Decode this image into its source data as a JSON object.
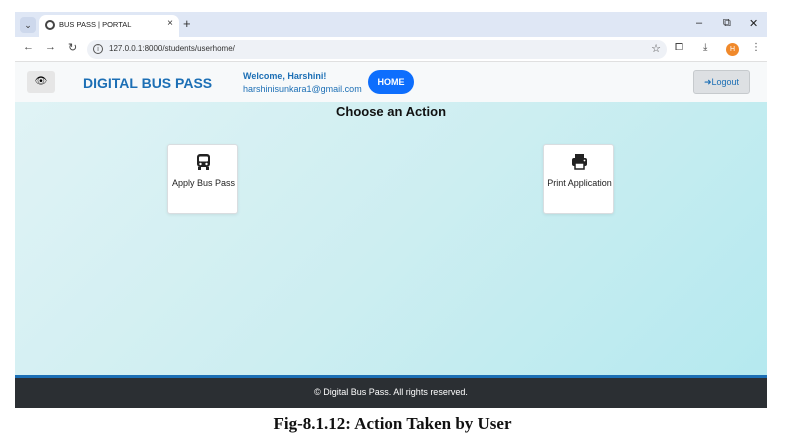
{
  "browser": {
    "tab_title": "BUS PASS | PORTAL",
    "tab_close": "×",
    "new_tab": "+",
    "url": "127.0.0.1:8000/students/userhome/",
    "profile_initial": "H",
    "icons": [
      "tab-menu-icon",
      "globe-icon",
      "close-icon",
      "plus-icon",
      "minimize-icon",
      "restore-icon",
      "window-close-icon",
      "back-icon",
      "forward-icon",
      "reload-icon",
      "info-icon",
      "star-icon",
      "extensions-icon",
      "download-icon",
      "menu-icon"
    ]
  },
  "navbar": {
    "brand": "DIGITAL BUS PASS",
    "welcome": "Welcome, Harshini!",
    "email": "harshinisunkara1@gmail.com",
    "home_label": "HOME",
    "logout_label": "Logout",
    "brand_color": "#1c6fb5",
    "home_color": "#0d6efd"
  },
  "main": {
    "heading": "Choose an Action",
    "actions": [
      {
        "label": "Apply Bus Pass",
        "icon": "bus-icon"
      },
      {
        "label": "Print Application",
        "icon": "printer-icon"
      }
    ]
  },
  "footer": {
    "text": "© Digital Bus Pass. All rights reserved."
  },
  "caption": "Fig-8.1.12: Action Taken by User"
}
